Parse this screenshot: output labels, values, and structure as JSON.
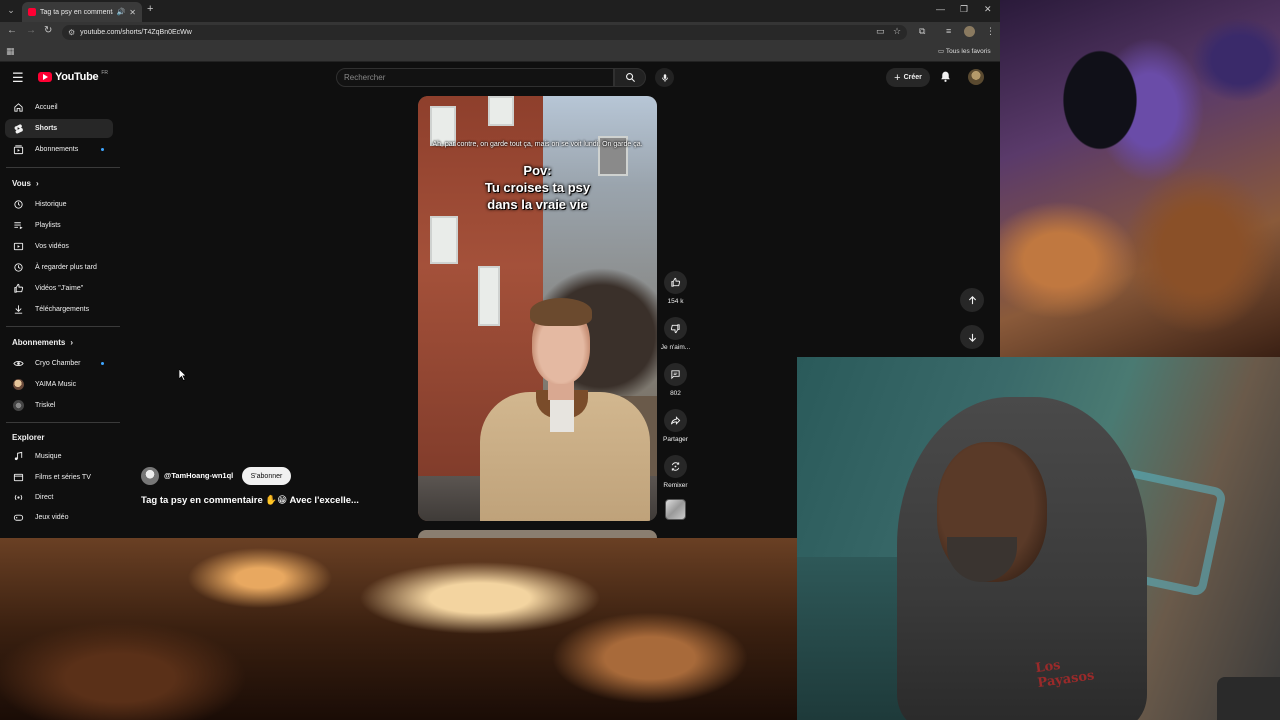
{
  "browser": {
    "tab_title": "Tag ta psy en commentaire",
    "url": "youtube.com/shorts/T4ZqBn0EcWw",
    "bookmarks_all_label": "Tous les favoris",
    "colors": {
      "tab_active": "#3a3a3a",
      "toolbar": "#353535",
      "accent": "#ff0033"
    }
  },
  "header": {
    "logo_text": "YouTube",
    "logo_badge": "FR",
    "search_placeholder": "Rechercher",
    "create_label": "Créer"
  },
  "sidebar": {
    "main": [
      {
        "label": "Accueil",
        "icon": "home-icon",
        "active": false
      },
      {
        "label": "Shorts",
        "icon": "shorts-icon",
        "active": true
      },
      {
        "label": "Abonnements",
        "icon": "subscriptions-icon",
        "active": false,
        "dot": true
      }
    ],
    "you_heading": "Vous",
    "you": [
      {
        "label": "Historique",
        "icon": "history-icon"
      },
      {
        "label": "Playlists",
        "icon": "playlists-icon"
      },
      {
        "label": "Vos vidéos",
        "icon": "your-videos-icon"
      },
      {
        "label": "À regarder plus tard",
        "icon": "watch-later-icon"
      },
      {
        "label": "Vidéos \"J'aime\"",
        "icon": "liked-videos-icon"
      },
      {
        "label": "Téléchargements",
        "icon": "downloads-icon"
      }
    ],
    "subs_heading": "Abonnements",
    "subs": [
      {
        "label": "Cryo Chamber",
        "dot": true
      },
      {
        "label": "YAIMA Music"
      },
      {
        "label": "Triskel"
      }
    ],
    "explore_heading": "Explorer",
    "explore": [
      {
        "label": "Musique",
        "icon": "music-icon"
      },
      {
        "label": "Films et séries TV",
        "icon": "movies-icon"
      },
      {
        "label": "Direct",
        "icon": "live-icon"
      },
      {
        "label": "Jeux vidéo",
        "icon": "gaming-icon"
      }
    ]
  },
  "short": {
    "caption_small": "Ah, par contre, on garde tout ça, mais on se voit lundi. On garde ça.",
    "caption_big_1": "Pov:",
    "caption_big_2": "Tu croises ta psy",
    "caption_big_3": "dans la vraie vie",
    "channel": "@TamHoang-wn1ql",
    "subscribe_label": "S'abonner",
    "title": "Tag ta psy en commentaire ✋😁 Avec l'excelle..."
  },
  "actions": {
    "likes": "154 k",
    "dislike_label": "Je n'aim...",
    "comments": "802",
    "share_label": "Partager",
    "remix_label": "Remixer"
  },
  "webcam": {
    "shirt_print": "Los Payasos"
  }
}
